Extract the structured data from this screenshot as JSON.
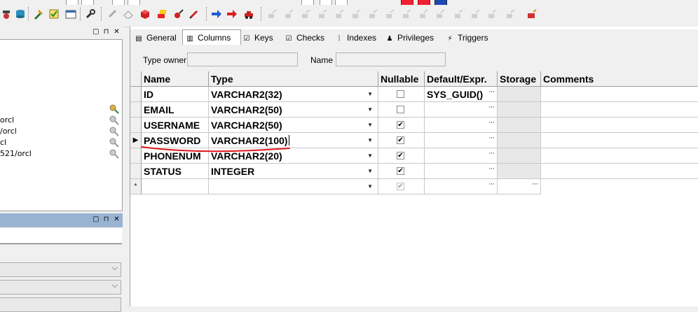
{
  "panels": {
    "tree_items": [
      "orcl",
      "/orcl",
      "cl",
      "521/orcl"
    ]
  },
  "tabs": [
    {
      "label": "General",
      "icon": "general-icon"
    },
    {
      "label": "Columns",
      "icon": "columns-icon",
      "active": true
    },
    {
      "label": "Keys",
      "icon": "keys-icon"
    },
    {
      "label": "Checks",
      "icon": "checks-icon"
    },
    {
      "label": "Indexes",
      "icon": "indexes-icon"
    },
    {
      "label": "Privileges",
      "icon": "privileges-icon"
    },
    {
      "label": "Triggers",
      "icon": "triggers-icon"
    }
  ],
  "owner_bar": {
    "type_owner_label": "Type owner",
    "type_owner_value": "",
    "name_label": "Name",
    "name_value": ""
  },
  "grid": {
    "headers": [
      "Name",
      "Type",
      "Nullable",
      "Default/Expr.",
      "Storage",
      "Comments"
    ],
    "rows": [
      {
        "name": "ID",
        "type": "VARCHAR2(32)",
        "nullable": false,
        "default": "SYS_GUID()"
      },
      {
        "name": "EMAIL",
        "type": "VARCHAR2(50)",
        "nullable": false,
        "default": ""
      },
      {
        "name": "USERNAME",
        "type": "VARCHAR2(50)",
        "nullable": true,
        "default": ""
      },
      {
        "name": "PASSWORD",
        "type": "VARCHAR2(100)",
        "nullable": true,
        "default": "",
        "current": true
      },
      {
        "name": "PHONENUM",
        "type": "VARCHAR2(20)",
        "nullable": true,
        "default": ""
      },
      {
        "name": "STATUS",
        "type": "INTEGER",
        "nullable": true,
        "default": ""
      }
    ],
    "new_row_marker": "*",
    "current_row_marker": "▶",
    "check_mark": "✔",
    "annotation_color": "#e0161b"
  }
}
